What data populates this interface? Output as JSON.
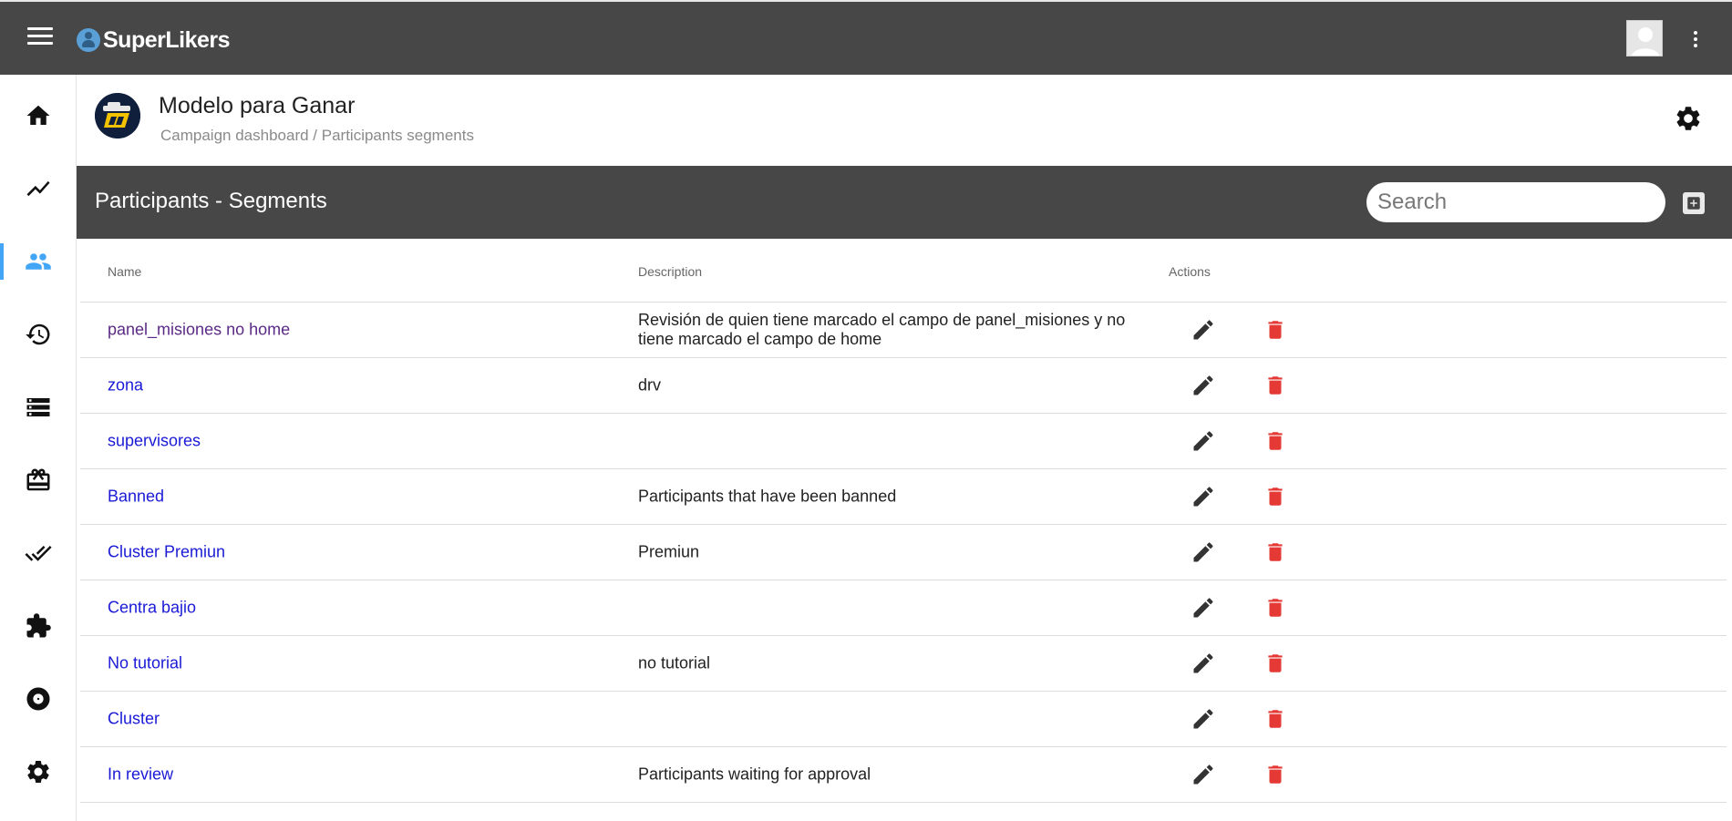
{
  "app": {
    "brand": "SuperLikers"
  },
  "colors": {
    "topbar": "#474747",
    "accent": "#42a5f5",
    "link": "#1a1ad6",
    "visited_link": "#5b2a86",
    "delete": "#e53935"
  },
  "sidebar": {
    "items": [
      {
        "icon": "home-icon"
      },
      {
        "icon": "trending-icon"
      },
      {
        "icon": "people-icon",
        "active": true
      },
      {
        "icon": "history-icon"
      },
      {
        "icon": "storage-icon"
      },
      {
        "icon": "gift-card-icon"
      },
      {
        "icon": "done-all-icon"
      },
      {
        "icon": "extension-icon"
      },
      {
        "icon": "album-icon"
      },
      {
        "icon": "settings-icon"
      }
    ]
  },
  "campaign": {
    "title": "Modelo para Ganar",
    "breadcrumb": {
      "root": "Campaign dashboard",
      "separator": " / ",
      "current": "Participants segments"
    }
  },
  "section": {
    "title": "Participants - Segments",
    "search_placeholder": "Search"
  },
  "table": {
    "headers": {
      "name": "Name",
      "description": "Description",
      "actions": "Actions"
    },
    "rows": [
      {
        "name": "panel_misiones no home",
        "description": "Revisión de quien tiene marcado el campo de panel_misiones y no tiene marcado el campo de home",
        "visited": true
      },
      {
        "name": "zona",
        "description": "drv"
      },
      {
        "name": "supervisores",
        "description": ""
      },
      {
        "name": "Banned",
        "description": "Participants that have been banned"
      },
      {
        "name": "Cluster Premiun",
        "description": "Premiun"
      },
      {
        "name": "Centra bajio",
        "description": ""
      },
      {
        "name": "No tutorial",
        "description": "no tutorial"
      },
      {
        "name": "Cluster",
        "description": ""
      },
      {
        "name": "In review",
        "description": "Participants waiting for approval"
      }
    ]
  }
}
